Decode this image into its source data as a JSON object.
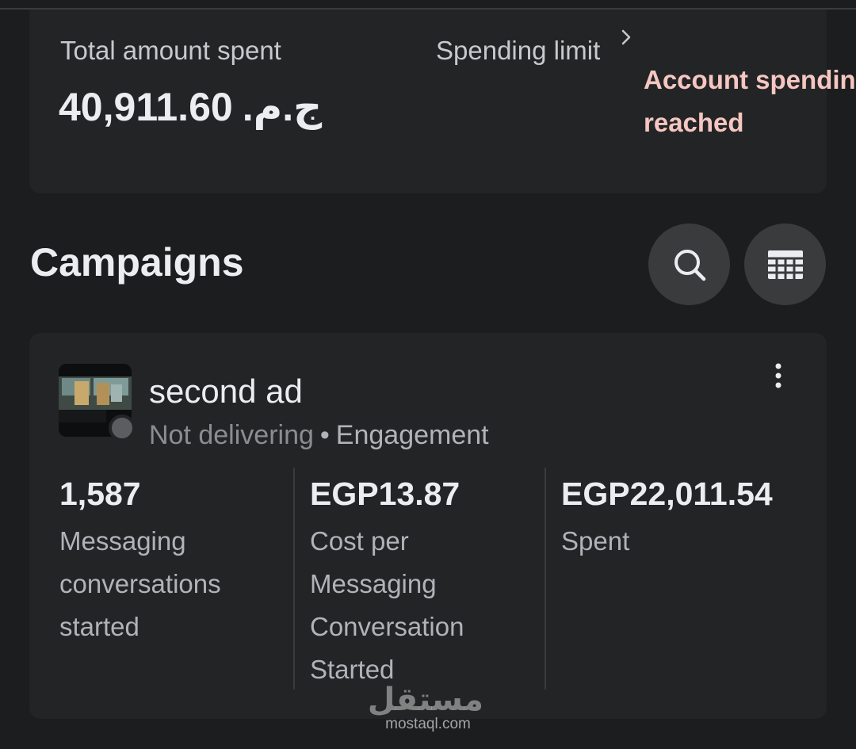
{
  "summary": {
    "total_label": "Total amount spent",
    "total_value": "40,911.60",
    "total_currency": "ج.م.",
    "limit_label": "Spending limit",
    "limit_warning_line1": "Account spending limit",
    "limit_warning_line2": "reached"
  },
  "campaigns": {
    "title": "Campaigns",
    "search_icon": "search-icon",
    "table_icon": "table-icon"
  },
  "campaign": {
    "name": "second ad",
    "delivery": "Not delivering",
    "separator": "•",
    "objective": "Engagement",
    "metrics": [
      {
        "value": "1,587",
        "label": "Messaging conversations started"
      },
      {
        "value": "EGP13.87",
        "label": "Cost per Messaging Conversation Started"
      },
      {
        "value": "EGP22,011.54",
        "label": "Spent"
      }
    ]
  },
  "colors": {
    "background": "#1c1d1f",
    "card": "#232426",
    "warning": "#f6c6c1",
    "button": "#3a3b3d"
  },
  "watermark": {
    "arabic": "مستقل",
    "latin": "mostaql.com"
  }
}
